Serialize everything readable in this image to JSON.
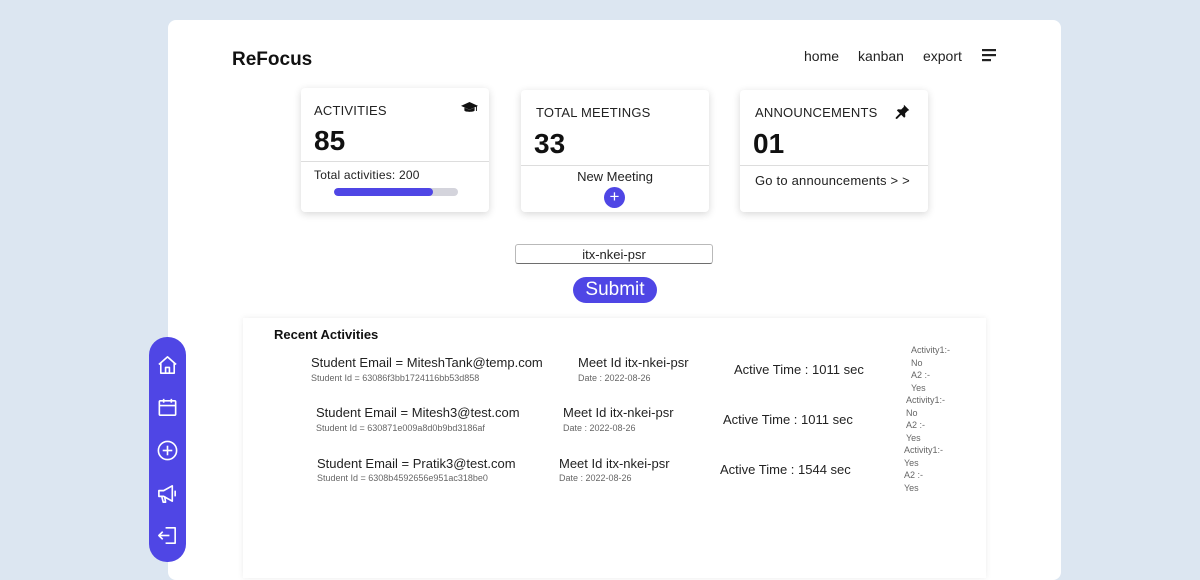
{
  "header": {
    "brand": "ReFocus",
    "nav": {
      "home": "home",
      "kanban": "kanban",
      "export": "export"
    }
  },
  "cards": {
    "activities": {
      "title": "ACTIVITIES",
      "value": "85",
      "total_label": "Total activities: 200",
      "progress_fraction": 0.8
    },
    "meetings": {
      "title": "TOTAL MEETINGS",
      "value": "33",
      "action_label": "New Meeting",
      "add_symbol": "+"
    },
    "announcements": {
      "title": "ANNOUNCEMENTS",
      "value": "01",
      "link_label": "Go to announcements > >"
    }
  },
  "meet_form": {
    "input_value": "itx-nkei-psr",
    "submit_label": "Submit"
  },
  "recent": {
    "title": "Recent Activities",
    "rows": [
      {
        "email": "Student Email = MiteshTank@temp.com",
        "student_id": "Student Id = 63086f3bb1724116bb53d858",
        "meet_id": "Meet Id itx-nkei-psr",
        "date": "Date : 2022-08-26",
        "active_time": "Active Time : 1011 sec",
        "activities": [
          "Activity1:-",
          "No",
          "A2 :-",
          "Yes"
        ]
      },
      {
        "email": "Student Email = Mitesh3@test.com",
        "student_id": "Student Id = 630871e009a8d0b9bd3186af",
        "meet_id": "Meet Id itx-nkei-psr",
        "date": "Date : 2022-08-26",
        "active_time": "Active Time : 1011 sec",
        "activities": [
          "Activity1:-",
          "No",
          "A2 :-",
          "Yes"
        ]
      },
      {
        "email": "Student Email = Pratik3@test.com",
        "student_id": "Student Id = 6308b4592656e951ac318be0",
        "meet_id": "Meet Id itx-nkei-psr",
        "date": "Date : 2022-08-26",
        "active_time": "Active Time : 1544 sec",
        "activities": [
          "Activity1:-",
          "Yes",
          "A2 :-",
          "Yes"
        ]
      }
    ]
  },
  "sidebar_icons": [
    "home-icon",
    "calendar-icon",
    "plus-circle-icon",
    "megaphone-icon",
    "logout-icon"
  ],
  "colors": {
    "accent": "#4f46e5",
    "background": "#dce6f1",
    "panel": "#ffffff"
  }
}
